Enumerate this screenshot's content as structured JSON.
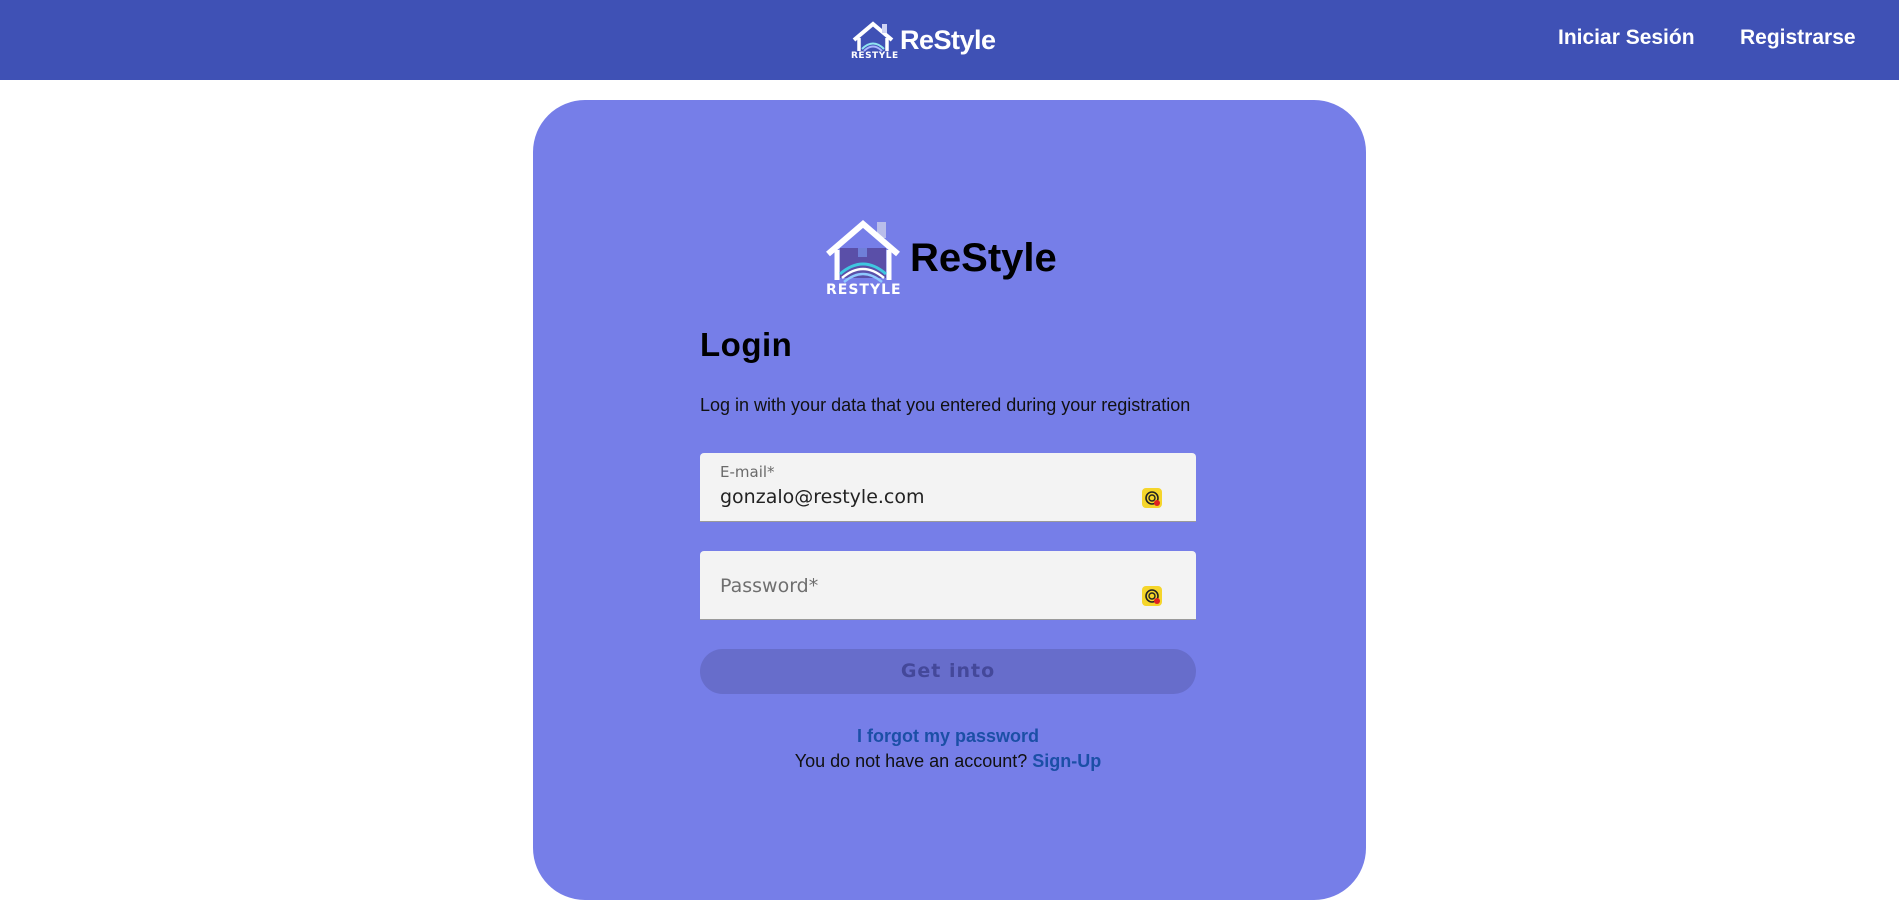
{
  "header": {
    "brand": "ReStyle",
    "logo_caption": "RESTYLE",
    "nav": {
      "login": "Iniciar Sesión",
      "register": "Registrarse"
    }
  },
  "card": {
    "brand": "ReStyle",
    "logo_caption": "RESTYLE",
    "title": "Login",
    "subtitle": "Log in with your data that you entered during your registration",
    "email": {
      "label": "E-mail*",
      "value": "gonzalo@restyle.com"
    },
    "password": {
      "placeholder": "Password*",
      "value": ""
    },
    "submit_label": "Get into",
    "forgot_label": "I forgot my password",
    "no_account_text": "You do not have an account?",
    "signup_label": "Sign-Up"
  },
  "colors": {
    "header_bg": "#3f51b5",
    "card_bg": "#767ee8",
    "button_bg": "#676dcb",
    "link": "#1b4fa6"
  },
  "icons": [
    "house-logo-icon",
    "password-manager-extension-icon"
  ]
}
